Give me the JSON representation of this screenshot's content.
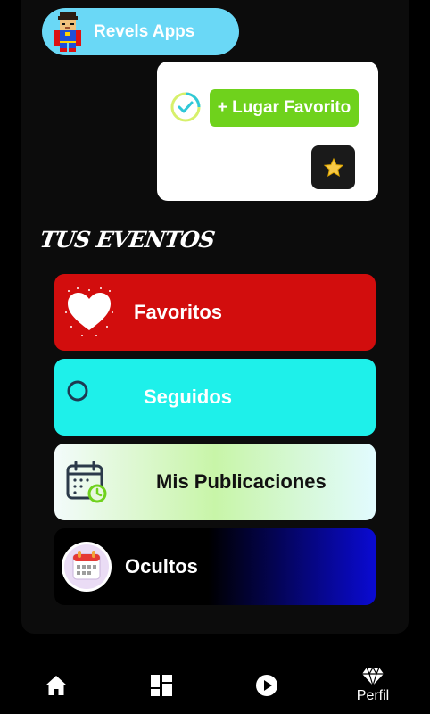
{
  "header": {
    "app_name": "Revels Apps"
  },
  "favorite_card": {
    "add_label": "+ Lugar Favorito"
  },
  "section": {
    "title": "TUS EVENTOS"
  },
  "events": [
    {
      "label": "Favoritos"
    },
    {
      "label": "Seguidos"
    },
    {
      "label": "Mis Publicaciones"
    },
    {
      "label": "Ocultos"
    }
  ],
  "nav": {
    "items": [
      {
        "icon": "home-icon"
      },
      {
        "icon": "grid-icon"
      },
      {
        "icon": "play-icon"
      },
      {
        "icon": "diamond-icon",
        "label": "Perfil"
      }
    ]
  },
  "colors": {
    "accent_green": "#6fd21c",
    "pill_blue": "#6ad8f6",
    "favorites_red": "#d20d0d",
    "followed_cyan": "#1ef0ea",
    "hidden_blue": "#0a0ad2"
  }
}
